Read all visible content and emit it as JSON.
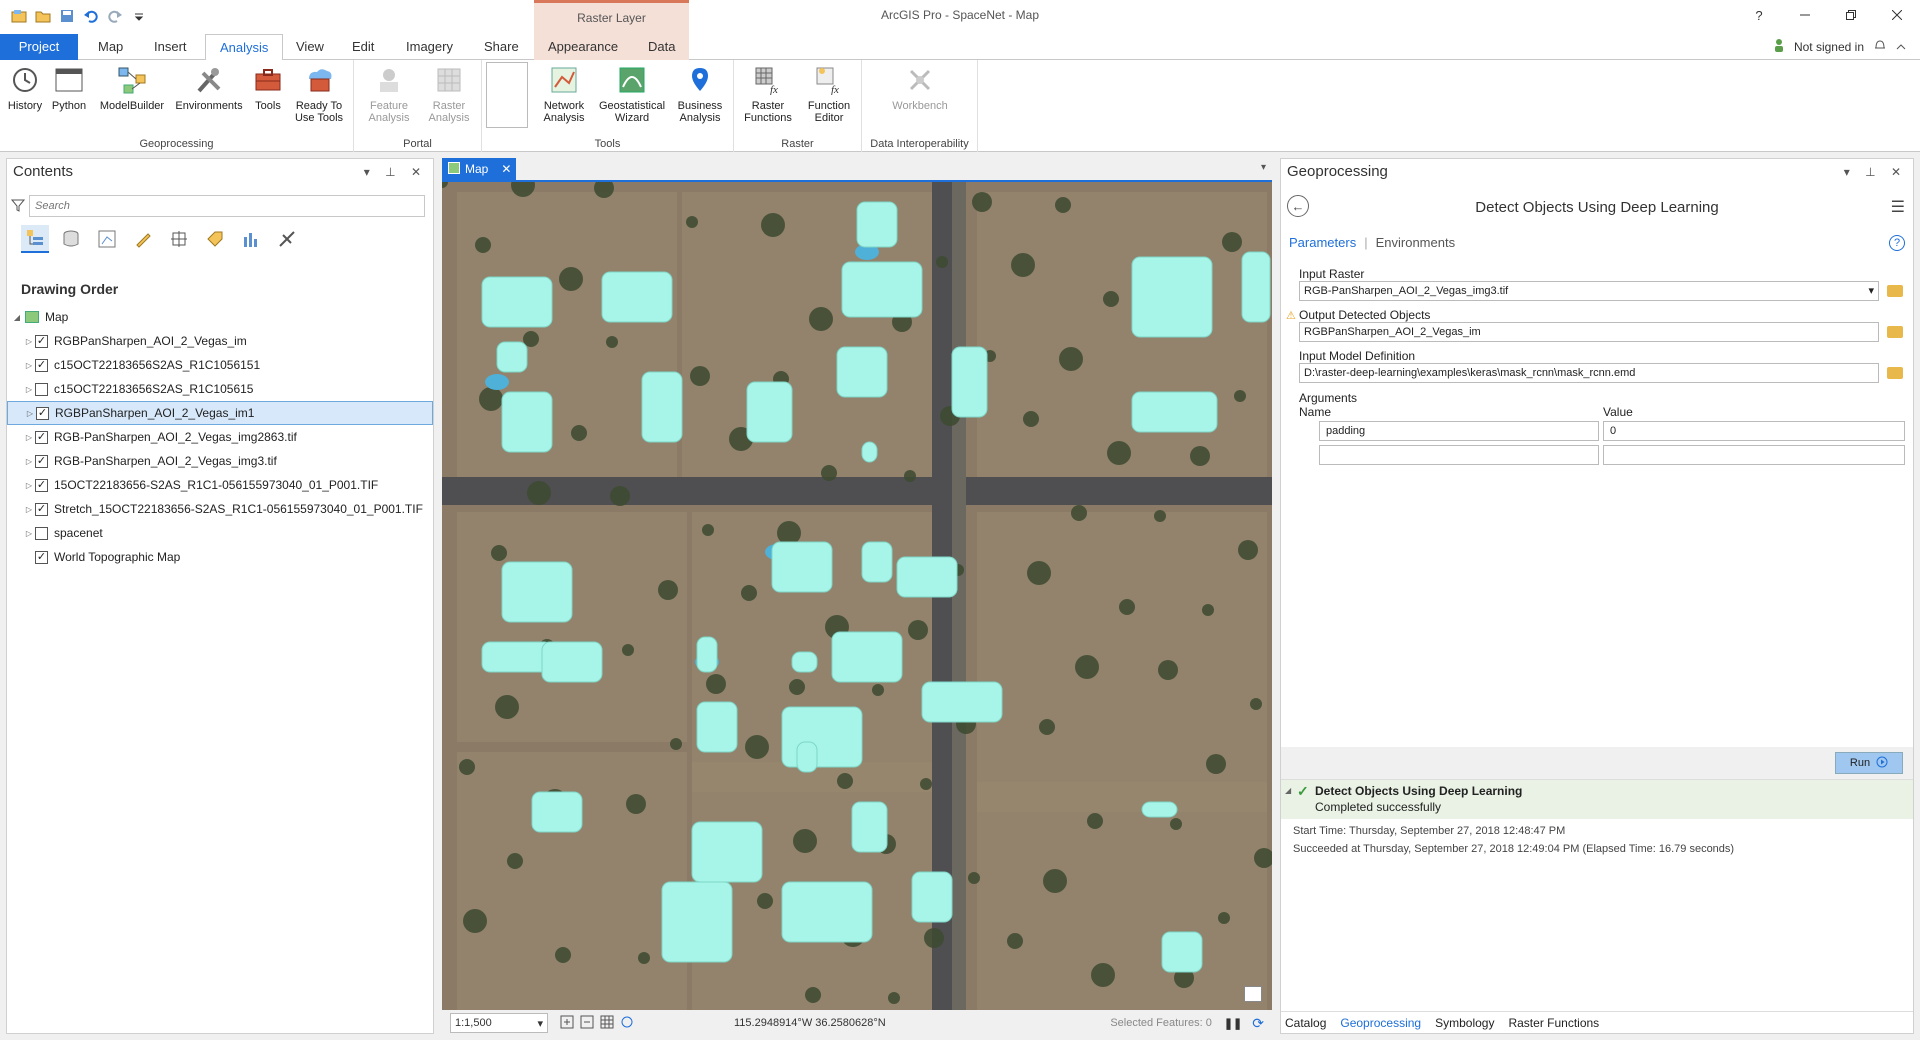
{
  "app": {
    "title": "ArcGIS Pro - SpaceNet - Map",
    "contextual_tab_header": "Raster Layer",
    "help_glyph": "?",
    "signin": "Not signed in"
  },
  "ribbon_tabs": [
    "Project",
    "Map",
    "Insert",
    "Analysis",
    "View",
    "Edit",
    "Imagery",
    "Share",
    "Appearance",
    "Data"
  ],
  "ribbon": {
    "geoprocessing": {
      "label": "Geoprocessing",
      "buttons": [
        "History",
        "Python",
        "ModelBuilder",
        "Environments",
        "Tools"
      ],
      "ready_to_use_1": "Ready To",
      "ready_to_use_2": "Use Tools"
    },
    "portal": {
      "label": "Portal",
      "feature_1": "Feature",
      "feature_2": "Analysis",
      "raster_1": "Raster",
      "raster_2": "Analysis"
    },
    "tools": {
      "label": "Tools",
      "network_1": "Network",
      "network_2": "Analysis",
      "geostat_1": "Geostatistical",
      "geostat_2": "Wizard",
      "business_1": "Business",
      "business_2": "Analysis"
    },
    "raster": {
      "label": "Raster",
      "functions_1": "Raster",
      "functions_2": "Functions",
      "editor_1": "Function",
      "editor_2": "Editor"
    },
    "interop": {
      "label": "Data Interoperability",
      "workbench": "Workbench"
    }
  },
  "contents": {
    "title": "Contents",
    "search_placeholder": "Search",
    "drawing_order": "Drawing Order",
    "map_label": "Map",
    "layers": [
      {
        "name": "RGBPanSharpen_AOI_2_Vegas_im",
        "checked": true
      },
      {
        "name": "c15OCT22183656S2AS_R1C1056151",
        "checked": true
      },
      {
        "name": "c15OCT22183656S2AS_R1C105615",
        "checked": false
      },
      {
        "name": "RGBPanSharpen_AOI_2_Vegas_im1",
        "checked": true,
        "selected": true
      },
      {
        "name": "RGB-PanSharpen_AOI_2_Vegas_img2863.tif",
        "checked": true
      },
      {
        "name": "RGB-PanSharpen_AOI_2_Vegas_img3.tif",
        "checked": true
      },
      {
        "name": "15OCT22183656-S2AS_R1C1-056155973040_01_P001.TIF",
        "checked": true
      },
      {
        "name": "Stretch_15OCT22183656-S2AS_R1C1-056155973040_01_P001.TIF",
        "checked": true
      },
      {
        "name": "spacenet",
        "checked": false
      },
      {
        "name": "World Topographic Map",
        "checked": true
      }
    ]
  },
  "map_view": {
    "tab_label": "Map",
    "scale": "1:1,500",
    "coordinates": "115.2948914°W 36.2580628°N",
    "selected_features": "Selected Features: 0"
  },
  "geoprocessing": {
    "pane_title": "Geoprocessing",
    "tool_title": "Detect Objects Using Deep Learning",
    "tab_parameters": "Parameters",
    "tab_environments": "Environments",
    "input_raster_label": "Input Raster",
    "input_raster_value": "RGB-PanSharpen_AOI_2_Vegas_img3.tif",
    "output_label": "Output Detected Objects",
    "output_value": "RGBPanSharpen_AOI_2_Vegas_im",
    "model_label": "Input Model Definition",
    "model_value": "D:\\raster-deep-learning\\examples\\keras\\mask_rcnn\\mask_rcnn.emd",
    "arguments_label": "Arguments",
    "col_name": "Name",
    "col_value": "Value",
    "arg_name": "padding",
    "arg_value": "0",
    "run_label": "Run",
    "result_title": "Detect Objects Using Deep Learning",
    "result_status": "Completed successfully",
    "start_time": "Start Time: Thursday, September 27, 2018 12:48:47 PM",
    "succeeded": "Succeeded at Thursday, September 27, 2018 12:49:04 PM (Elapsed Time: 16.79 seconds)",
    "bottom_tabs": [
      "Catalog",
      "Geoprocessing",
      "Symbology",
      "Raster Functions"
    ]
  },
  "colors": {
    "accent": "#1e6fd9",
    "detection_fill": "#a6f5e8",
    "contextual_tab": "#f5e0d8"
  }
}
